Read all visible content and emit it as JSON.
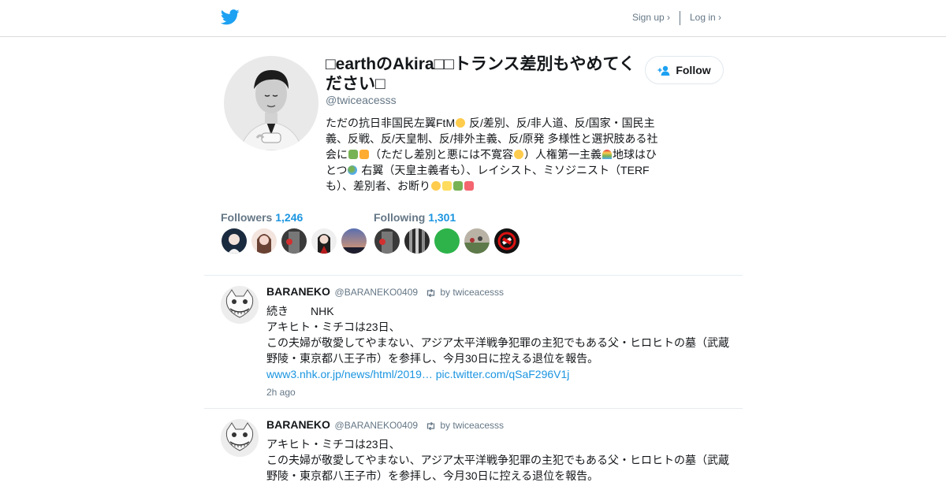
{
  "header": {
    "logo_icon": "twitter-bird-icon",
    "signup_label": "Sign up ›",
    "login_label": "Log in ›"
  },
  "profile": {
    "name": "□earthのAkira□□トランス差別もやめてください□",
    "handle": "@twiceacesss",
    "follow_label": "Follow",
    "bio_lines": [
      "ただの抗日非国民左翼FtM",
      " 反/差別、反/非人道、反/国家・国民主義、反戦、反/天皇制、反/排外主義、反/原発 多様性と選択肢ある社会に",
      "（ただし差別と悪には不寛容",
      "）人権第一主義",
      "地球はひとつ",
      " 右翼（天皇主義者も）、レイシスト、ミソジニスト（TERFも）、差別者、お断り"
    ]
  },
  "stats": {
    "followers_label": "Followers",
    "followers_count": "1,246",
    "following_label": "Following",
    "following_count": "1,301"
  },
  "tweets": [
    {
      "name": "BARANEKO",
      "handle": "@BARANEKO0409",
      "retweet_by": "by twiceacesss",
      "lines": [
        "続き　　NHK",
        "アキヒト・ミチコは23日、",
        "この夫婦が敬愛してやまない、アジア太平洋戦争犯罪の主犯でもある父・ヒロヒトの墓（武蔵野陵・東京都八王子市）を参拝し、今月30日に控える退位を報告。"
      ],
      "link1": "www3.nhk.or.jp/news/html/2019…",
      "link2": "pic.twitter.com/qSaF296V1j",
      "time": "2h ago"
    },
    {
      "name": "BARANEKO",
      "handle": "@BARANEKO0409",
      "retweet_by": "by twiceacesss",
      "lines": [
        "アキヒト・ミチコは23日、",
        "この夫婦が敬愛してやまない、アジア太平洋戦争犯罪の主犯でもある父・ヒロヒトの墓（武蔵野陵・東京都八王子市）を参拝し、今月30日に控える退位を報告。"
      ]
    }
  ],
  "colors": {
    "brand": "#1da1f2",
    "link": "#1b95e0",
    "muted": "#657786",
    "border": "#e6ecf0"
  }
}
